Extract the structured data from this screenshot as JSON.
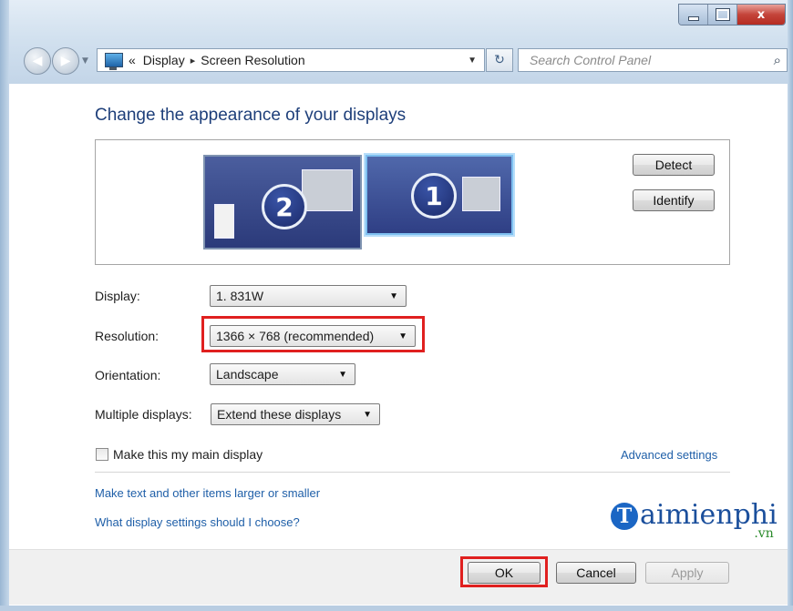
{
  "window": {
    "buttons": {
      "minimize": "–",
      "maximize": "□",
      "close": "x"
    }
  },
  "address": {
    "prefix": "«",
    "crumbs": [
      "Display",
      "Screen Resolution"
    ],
    "separator": "▸",
    "search_placeholder": "Search Control Panel"
  },
  "main": {
    "heading": "Change the appearance of your displays",
    "monitors": [
      {
        "number": "2"
      },
      {
        "number": "1"
      }
    ],
    "detect_label": "Detect",
    "identify_label": "Identify",
    "fields": {
      "display": {
        "label": "Display:",
        "value": "1. 831W"
      },
      "resolution": {
        "label": "Resolution:",
        "value": "1366 × 768 (recommended)"
      },
      "orientation": {
        "label": "Orientation:",
        "value": "Landscape"
      },
      "multiple": {
        "label": "Multiple displays:",
        "value": "Extend these displays"
      }
    },
    "main_display_label": "Make this my main display",
    "advanced_link": "Advanced settings",
    "links": [
      "Make text and other items larger or smaller",
      "What display settings should I choose?"
    ]
  },
  "footer": {
    "ok": "OK",
    "cancel": "Cancel",
    "apply": "Apply"
  },
  "watermark": {
    "text": "aimienphi",
    "initial": "T",
    "suffix": ".vn"
  },
  "colors": {
    "heading": "#1e3f7a",
    "link": "#1f5fa8",
    "highlight": "#e0201f"
  },
  "icons": [
    "back-arrow-icon",
    "forward-arrow-icon",
    "control-panel-icon",
    "refresh-icon",
    "search-icon"
  ]
}
